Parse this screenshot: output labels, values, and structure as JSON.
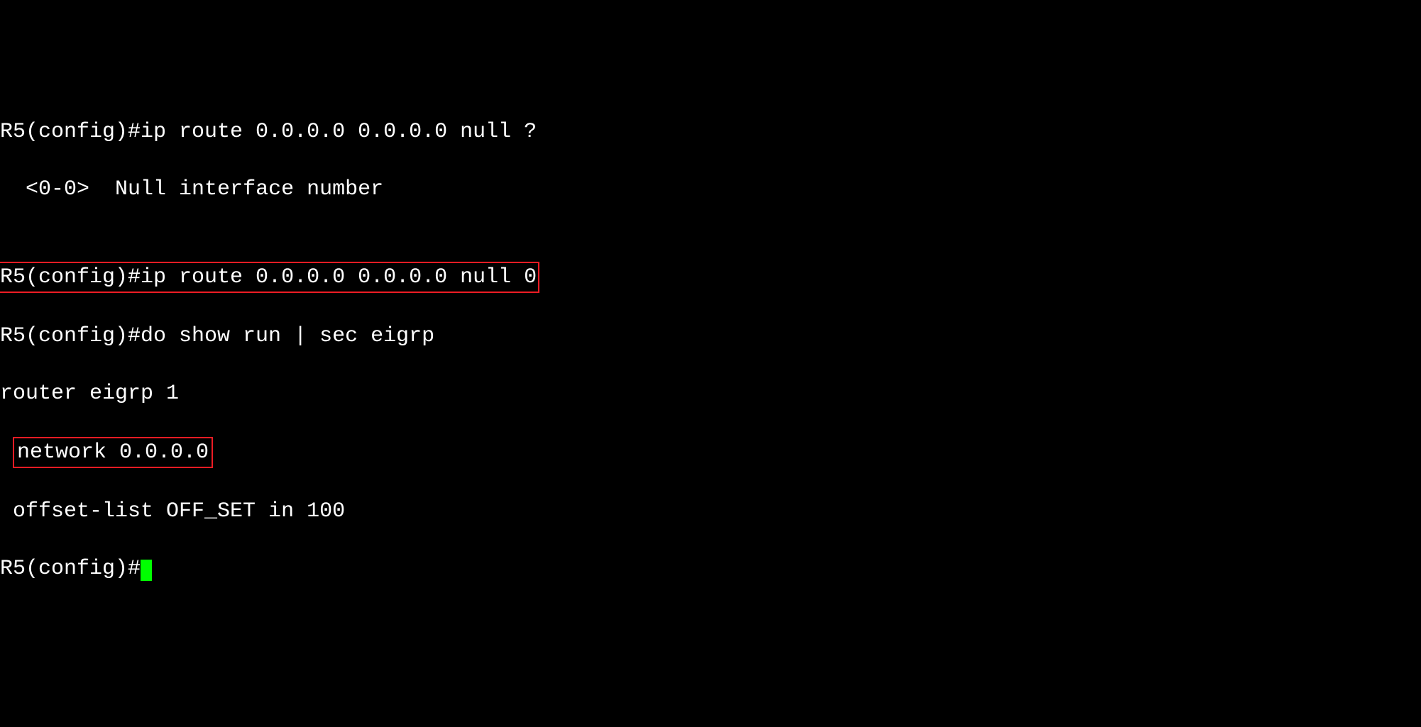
{
  "terminal": {
    "line1": "R5(config)#ip route 0.0.0.0 0.0.0.0 null ?",
    "line2_indent": "  ",
    "line2_range": "<0-0>",
    "line2_desc": "  Null interface number",
    "line3": "",
    "line4_boxed": "R5(config)#ip route 0.0.0.0 0.0.0.0 null 0",
    "line5": "R5(config)#do show run | sec eigrp",
    "line6": "router eigrp 1",
    "line7_prefix": " ",
    "line7_boxed": "network 0.0.0.0",
    "line8": " offset-list OFF_SET in 100",
    "line9": "R5(config)#"
  }
}
